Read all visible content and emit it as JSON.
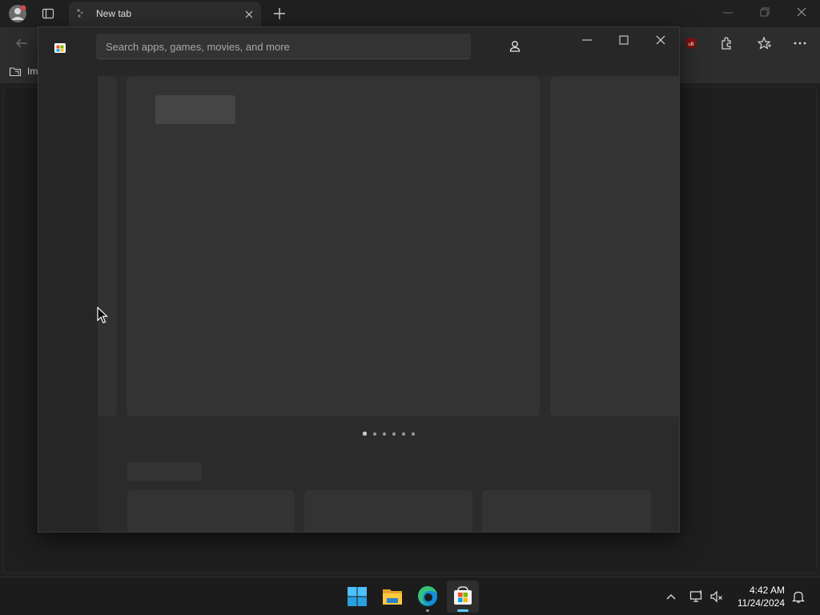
{
  "browser": {
    "tab": {
      "title": "New tab"
    },
    "favorites_bar": {
      "first_item_label": "Im"
    },
    "extension_badge": "uB"
  },
  "store": {
    "search": {
      "placeholder": "Search apps, games, movies, and more"
    }
  },
  "taskbar": {
    "clock": {
      "time": "4:42 AM",
      "date": "11/24/2024"
    }
  },
  "icons": [
    "profile-avatar-icon",
    "tab-actions-icon",
    "edge-tab-favicon",
    "tab-close-icon",
    "new-tab-icon",
    "back-icon",
    "favorites-folder-icon",
    "ublock-icon",
    "extensions-icon",
    "favorites-icon",
    "more-menu-icon",
    "store-logo-icon",
    "account-icon",
    "minimize-icon",
    "maximize-icon",
    "close-icon",
    "windows-start-icon",
    "file-explorer-icon",
    "edge-icon",
    "store-icon",
    "chevron-up-icon",
    "network-icon",
    "volume-muted-icon",
    "notification-bell-icon"
  ],
  "colors": {
    "accent": "#60cdff",
    "dark_bg": "#202020",
    "store_bg": "#2b2b2b"
  }
}
